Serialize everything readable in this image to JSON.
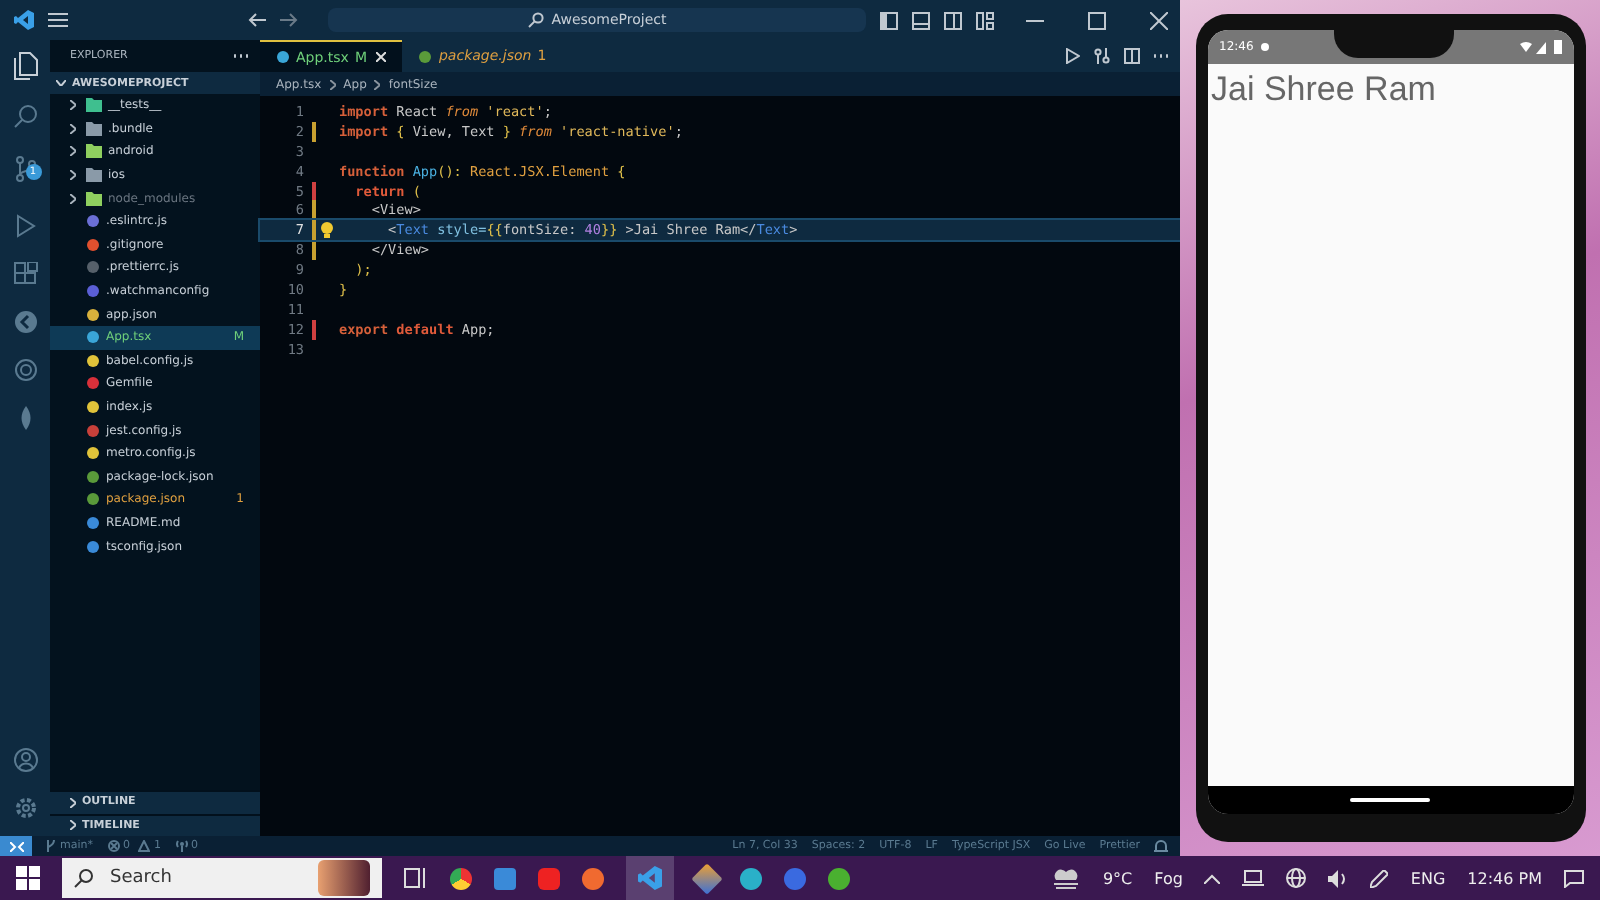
{
  "title_bar": {
    "search": "AwesomeProject"
  },
  "activity_badge": "1",
  "explorer": {
    "header": "EXPLORER",
    "root": "AWESOMEPROJECT",
    "items": [
      {
        "name": "__tests__",
        "folder": true,
        "color": "#3fbf8f",
        "kind": "normal",
        "selected": false
      },
      {
        "name": ".bundle",
        "folder": true,
        "color": "#8a9aa8",
        "kind": "normal",
        "selected": false
      },
      {
        "name": "android",
        "folder": true,
        "color": "#8fcf5f",
        "kind": "normal",
        "selected": false
      },
      {
        "name": "ios",
        "folder": true,
        "color": "#8a9aa8",
        "kind": "normal",
        "selected": false
      },
      {
        "name": "node_modules",
        "folder": true,
        "color": "#8fcf5f",
        "kind": "ignored",
        "selected": false
      },
      {
        "name": ".eslintrc.js",
        "folder": false,
        "color": "#6b6fd6",
        "kind": "normal",
        "selected": false
      },
      {
        "name": ".gitignore",
        "folder": false,
        "color": "#e0502e",
        "kind": "normal",
        "selected": false
      },
      {
        "name": ".prettierrc.js",
        "folder": false,
        "color": "#56606a",
        "kind": "normal",
        "selected": false
      },
      {
        "name": ".watchmanconfig",
        "folder": false,
        "color": "#5b5fd6",
        "kind": "normal",
        "selected": false
      },
      {
        "name": "app.json",
        "folder": false,
        "color": "#d8b13c",
        "kind": "normal",
        "selected": false
      },
      {
        "name": "App.tsx",
        "folder": false,
        "color": "#3aa6d8",
        "kind": "modified",
        "status": "M",
        "selected": true
      },
      {
        "name": "babel.config.js",
        "folder": false,
        "color": "#e0c33a",
        "kind": "normal",
        "selected": false
      },
      {
        "name": "Gemfile",
        "folder": false,
        "color": "#d8303a",
        "kind": "normal",
        "selected": false
      },
      {
        "name": "index.js",
        "folder": false,
        "color": "#e0c33a",
        "kind": "normal",
        "selected": false
      },
      {
        "name": "jest.config.js",
        "folder": false,
        "color": "#c8403a",
        "kind": "normal",
        "selected": false
      },
      {
        "name": "metro.config.js",
        "folder": false,
        "color": "#e0c33a",
        "kind": "normal",
        "selected": false
      },
      {
        "name": "package-lock.json",
        "folder": false,
        "color": "#5a9a3a",
        "kind": "normal",
        "selected": false
      },
      {
        "name": "package.json",
        "folder": false,
        "color": "#5a9a3a",
        "kind": "error",
        "status": "1",
        "selected": false
      },
      {
        "name": "README.md",
        "folder": false,
        "color": "#3a8ad8",
        "kind": "normal",
        "selected": false
      },
      {
        "name": "tsconfig.json",
        "folder": false,
        "color": "#3a8ad8",
        "kind": "normal",
        "selected": false
      }
    ],
    "sections": [
      "OUTLINE",
      "TIMELINE"
    ]
  },
  "tabs": [
    {
      "label": "App.tsx",
      "badge": "M",
      "selected": true,
      "kind": "modified",
      "color": "#3aa6d8"
    },
    {
      "label": "package.json",
      "badge": "1",
      "selected": false,
      "kind": "error",
      "color": "#5a9a3a"
    }
  ],
  "breadcrumb": [
    "App.tsx",
    "App",
    "fontSize"
  ],
  "code": [
    {
      "number": "1",
      "kind": "none",
      "selected": false,
      "tokens": [
        {
          "text": "import",
          "kind": "keyword"
        },
        {
          "text": " React ",
          "kind": "plain"
        },
        {
          "text": "from",
          "kind": "italic"
        },
        {
          "text": " 'react'",
          "kind": "string"
        },
        {
          "text": ";",
          "kind": "plain"
        }
      ]
    },
    {
      "number": "2",
      "kind": "modified",
      "selected": false,
      "tokens": [
        {
          "text": "import",
          "kind": "keyword"
        },
        {
          "text": " { ",
          "kind": "punct"
        },
        {
          "text": "View, Text",
          "kind": "plain"
        },
        {
          "text": " } ",
          "kind": "punct"
        },
        {
          "text": "from",
          "kind": "italic"
        },
        {
          "text": " 'react-native'",
          "kind": "string"
        },
        {
          "text": ";",
          "kind": "plain"
        }
      ]
    },
    {
      "number": "3",
      "kind": "none",
      "selected": false
    },
    {
      "number": "4",
      "kind": "none",
      "selected": false,
      "tokens": [
        {
          "text": "function",
          "kind": "keyword"
        },
        {
          "text": " App",
          "kind": "func"
        },
        {
          "text": "(): ",
          "kind": "punct"
        },
        {
          "text": "React.JSX.Element",
          "kind": "type"
        },
        {
          "text": " {",
          "kind": "punct"
        }
      ]
    },
    {
      "number": "5",
      "kind": "deleted",
      "selected": false,
      "tokens": [
        {
          "text": "  return",
          "kind": "bold"
        },
        {
          "text": " (",
          "kind": "punct"
        }
      ]
    },
    {
      "number": "6",
      "kind": "modified",
      "selected": false,
      "tokens": [
        {
          "text": "    <View>",
          "kind": "plain"
        }
      ]
    },
    {
      "number": "7",
      "kind": "modified",
      "selected": true,
      "tokens": [
        {
          "text": "      <",
          "kind": "plain"
        },
        {
          "text": "Text",
          "kind": "tag"
        },
        {
          "text": " style=",
          "kind": "attr"
        },
        {
          "text": "{{",
          "kind": "punct"
        },
        {
          "text": "fontSize: ",
          "kind": "plain"
        },
        {
          "text": "40",
          "kind": "number"
        },
        {
          "text": "}}",
          "kind": "punct"
        },
        {
          "text": " >Jai Shree Ram</",
          "kind": "plain"
        },
        {
          "text": "Text",
          "kind": "tag"
        },
        {
          "text": ">",
          "kind": "plain"
        }
      ]
    },
    {
      "number": "8",
      "kind": "modified",
      "selected": false,
      "tokens": [
        {
          "text": "    </View>",
          "kind": "plain"
        }
      ]
    },
    {
      "number": "9",
      "kind": "none",
      "selected": false,
      "tokens": [
        {
          "text": "  );",
          "kind": "punct"
        }
      ]
    },
    {
      "number": "10",
      "kind": "none",
      "selected": false,
      "tokens": [
        {
          "text": "}",
          "kind": "punct"
        }
      ]
    },
    {
      "number": "11",
      "kind": "none",
      "selected": false
    },
    {
      "number": "12",
      "kind": "deleted",
      "selected": false,
      "tokens": [
        {
          "text": "export",
          "kind": "keyword"
        },
        {
          "text": " default",
          "kind": "bold"
        },
        {
          "text": " App;",
          "kind": "plain"
        }
      ]
    },
    {
      "number": "13",
      "kind": "none",
      "selected": false
    }
  ],
  "status_bar": {
    "branch": "main*",
    "errors": "0",
    "warnings": "1",
    "ports": "0",
    "right": [
      "Ln 7, Col 33",
      "Spaces: 2",
      "UTF-8",
      "LF",
      "TypeScript JSX",
      "Go Live",
      "Prettier"
    ]
  },
  "phone": {
    "time": "12:46",
    "content": "Jai Shree Ram"
  },
  "taskbar": {
    "search_placeholder": "Search",
    "temperature": "9°C",
    "weather": "Fog",
    "language": "ENG",
    "time": "12:46 PM"
  }
}
